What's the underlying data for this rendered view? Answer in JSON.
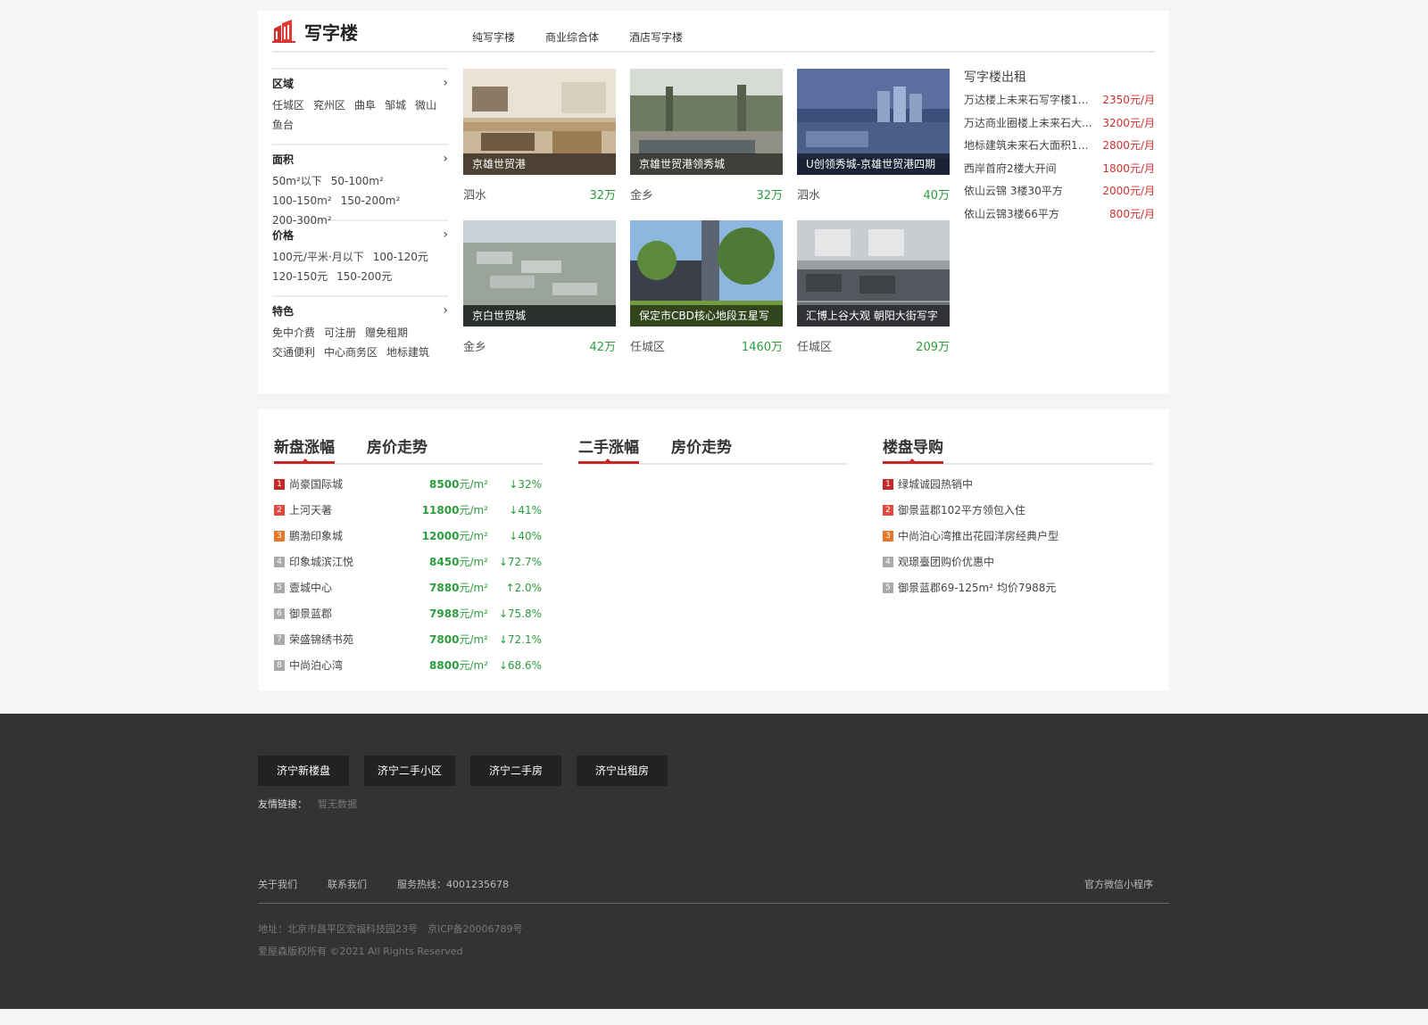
{
  "office": {
    "title": "写字楼",
    "tabs": [
      "纯写字楼",
      "商业综合体",
      "酒店写字楼"
    ],
    "filters": [
      {
        "label": "区域",
        "items": [
          "任城区",
          "兖州区",
          "曲阜",
          "邹城",
          "微山",
          "鱼台"
        ]
      },
      {
        "label": "面积",
        "items": [
          "50m²以下",
          "50-100m²",
          "100-150m²",
          "150-200m²",
          "200-300m²"
        ]
      },
      {
        "label": "价格",
        "items": [
          "100元/平米·月以下",
          "100-120元",
          "120-150元",
          "150-200元"
        ]
      },
      {
        "label": "特色",
        "items": [
          "免中介费",
          "可注册",
          "赠免租期",
          "交通便利",
          "中心商务区",
          "地标建筑"
        ]
      }
    ],
    "cards": [
      {
        "caption": "京雄世贸港",
        "location": "泗水",
        "price": "32万"
      },
      {
        "caption": "京雄世贸港领秀城",
        "location": "金乡",
        "price": "32万"
      },
      {
        "caption": "U创领秀城-京雄世贸港四期",
        "location": "泗水",
        "price": "40万"
      },
      {
        "caption": "京白世贸城",
        "location": "金乡",
        "price": "42万"
      },
      {
        "caption": "保定市CBD核心地段五星写",
        "location": "任城区",
        "price": "1460万"
      },
      {
        "caption": "汇博上谷大观 朝阳大街写字",
        "location": "任城区",
        "price": "209万"
      }
    ],
    "rent": {
      "title": "写字楼出租",
      "items": [
        {
          "name": "万达楼上未来石写字楼10...",
          "price": "2350元/月"
        },
        {
          "name": "万达商业圈楼上未来石大...",
          "price": "3200元/月"
        },
        {
          "name": "地标建筑未来石大面积11...",
          "price": "2800元/月"
        },
        {
          "name": "西岸首府2楼大开间",
          "price": "1800元/月"
        },
        {
          "name": "依山云锦 3楼30平方",
          "price": "2000元/月"
        },
        {
          "name": "依山云锦3楼66平方",
          "price": "800元/月"
        }
      ]
    }
  },
  "rank": {
    "new": {
      "tabs": [
        "新盘涨幅",
        "房价走势"
      ],
      "items": [
        {
          "no": "1",
          "name": "尚豪国际城",
          "price": "8500",
          "unit": "元/m²",
          "change": "↓32%"
        },
        {
          "no": "2",
          "name": "上河天著",
          "price": "11800",
          "unit": "元/m²",
          "change": "↓41%"
        },
        {
          "no": "3",
          "name": "鹏渤印象城",
          "price": "12000",
          "unit": "元/m²",
          "change": "↓40%"
        },
        {
          "no": "4",
          "name": "印象城滨江悦",
          "price": "8450",
          "unit": "元/m²",
          "change": "↓72.7%"
        },
        {
          "no": "5",
          "name": "壹城中心",
          "price": "7880",
          "unit": "元/m²",
          "change": "↑2.0%"
        },
        {
          "no": "6",
          "name": "御景蓝郡",
          "price": "7988",
          "unit": "元/m²",
          "change": "↓75.8%"
        },
        {
          "no": "7",
          "name": "荣盛锦绣书苑",
          "price": "7800",
          "unit": "元/m²",
          "change": "↓72.1%"
        },
        {
          "no": "8",
          "name": "中尚泊心湾",
          "price": "8800",
          "unit": "元/m²",
          "change": "↓68.6%"
        }
      ]
    },
    "second": {
      "tabs": [
        "二手涨幅",
        "房价走势"
      ]
    },
    "guide": {
      "title": "楼盘导购",
      "items": [
        {
          "no": "1",
          "text": "绿城诚园热销中"
        },
        {
          "no": "2",
          "text": "御景蓝郡102平方领包入住"
        },
        {
          "no": "3",
          "text": "中尚泊心湾推出花园洋房经典户型"
        },
        {
          "no": "4",
          "text": "观璟臺团购价优惠中"
        },
        {
          "no": "5",
          "text": "御景蓝郡69-125m² 均价7988元"
        }
      ]
    }
  },
  "footer": {
    "buttons": [
      "济宁新楼盘",
      "济宁二手小区",
      "济宁二手房",
      "济宁出租房"
    ],
    "friend_label": "友情链接：",
    "friend_value": "暂无数据",
    "nav": [
      "关于我们",
      "联系我们",
      "服务热线：4001235678"
    ],
    "mini": "官方微信小程序",
    "address": "地址：北京市昌平区宏福科技园23号　京ICP备20006789号",
    "copyright": "爱屋森版权所有 ©2021 All Rights Reserved"
  },
  "colors": {
    "accent": "#c62828",
    "green": "#2a9d3c",
    "footer_bg": "#333333"
  }
}
